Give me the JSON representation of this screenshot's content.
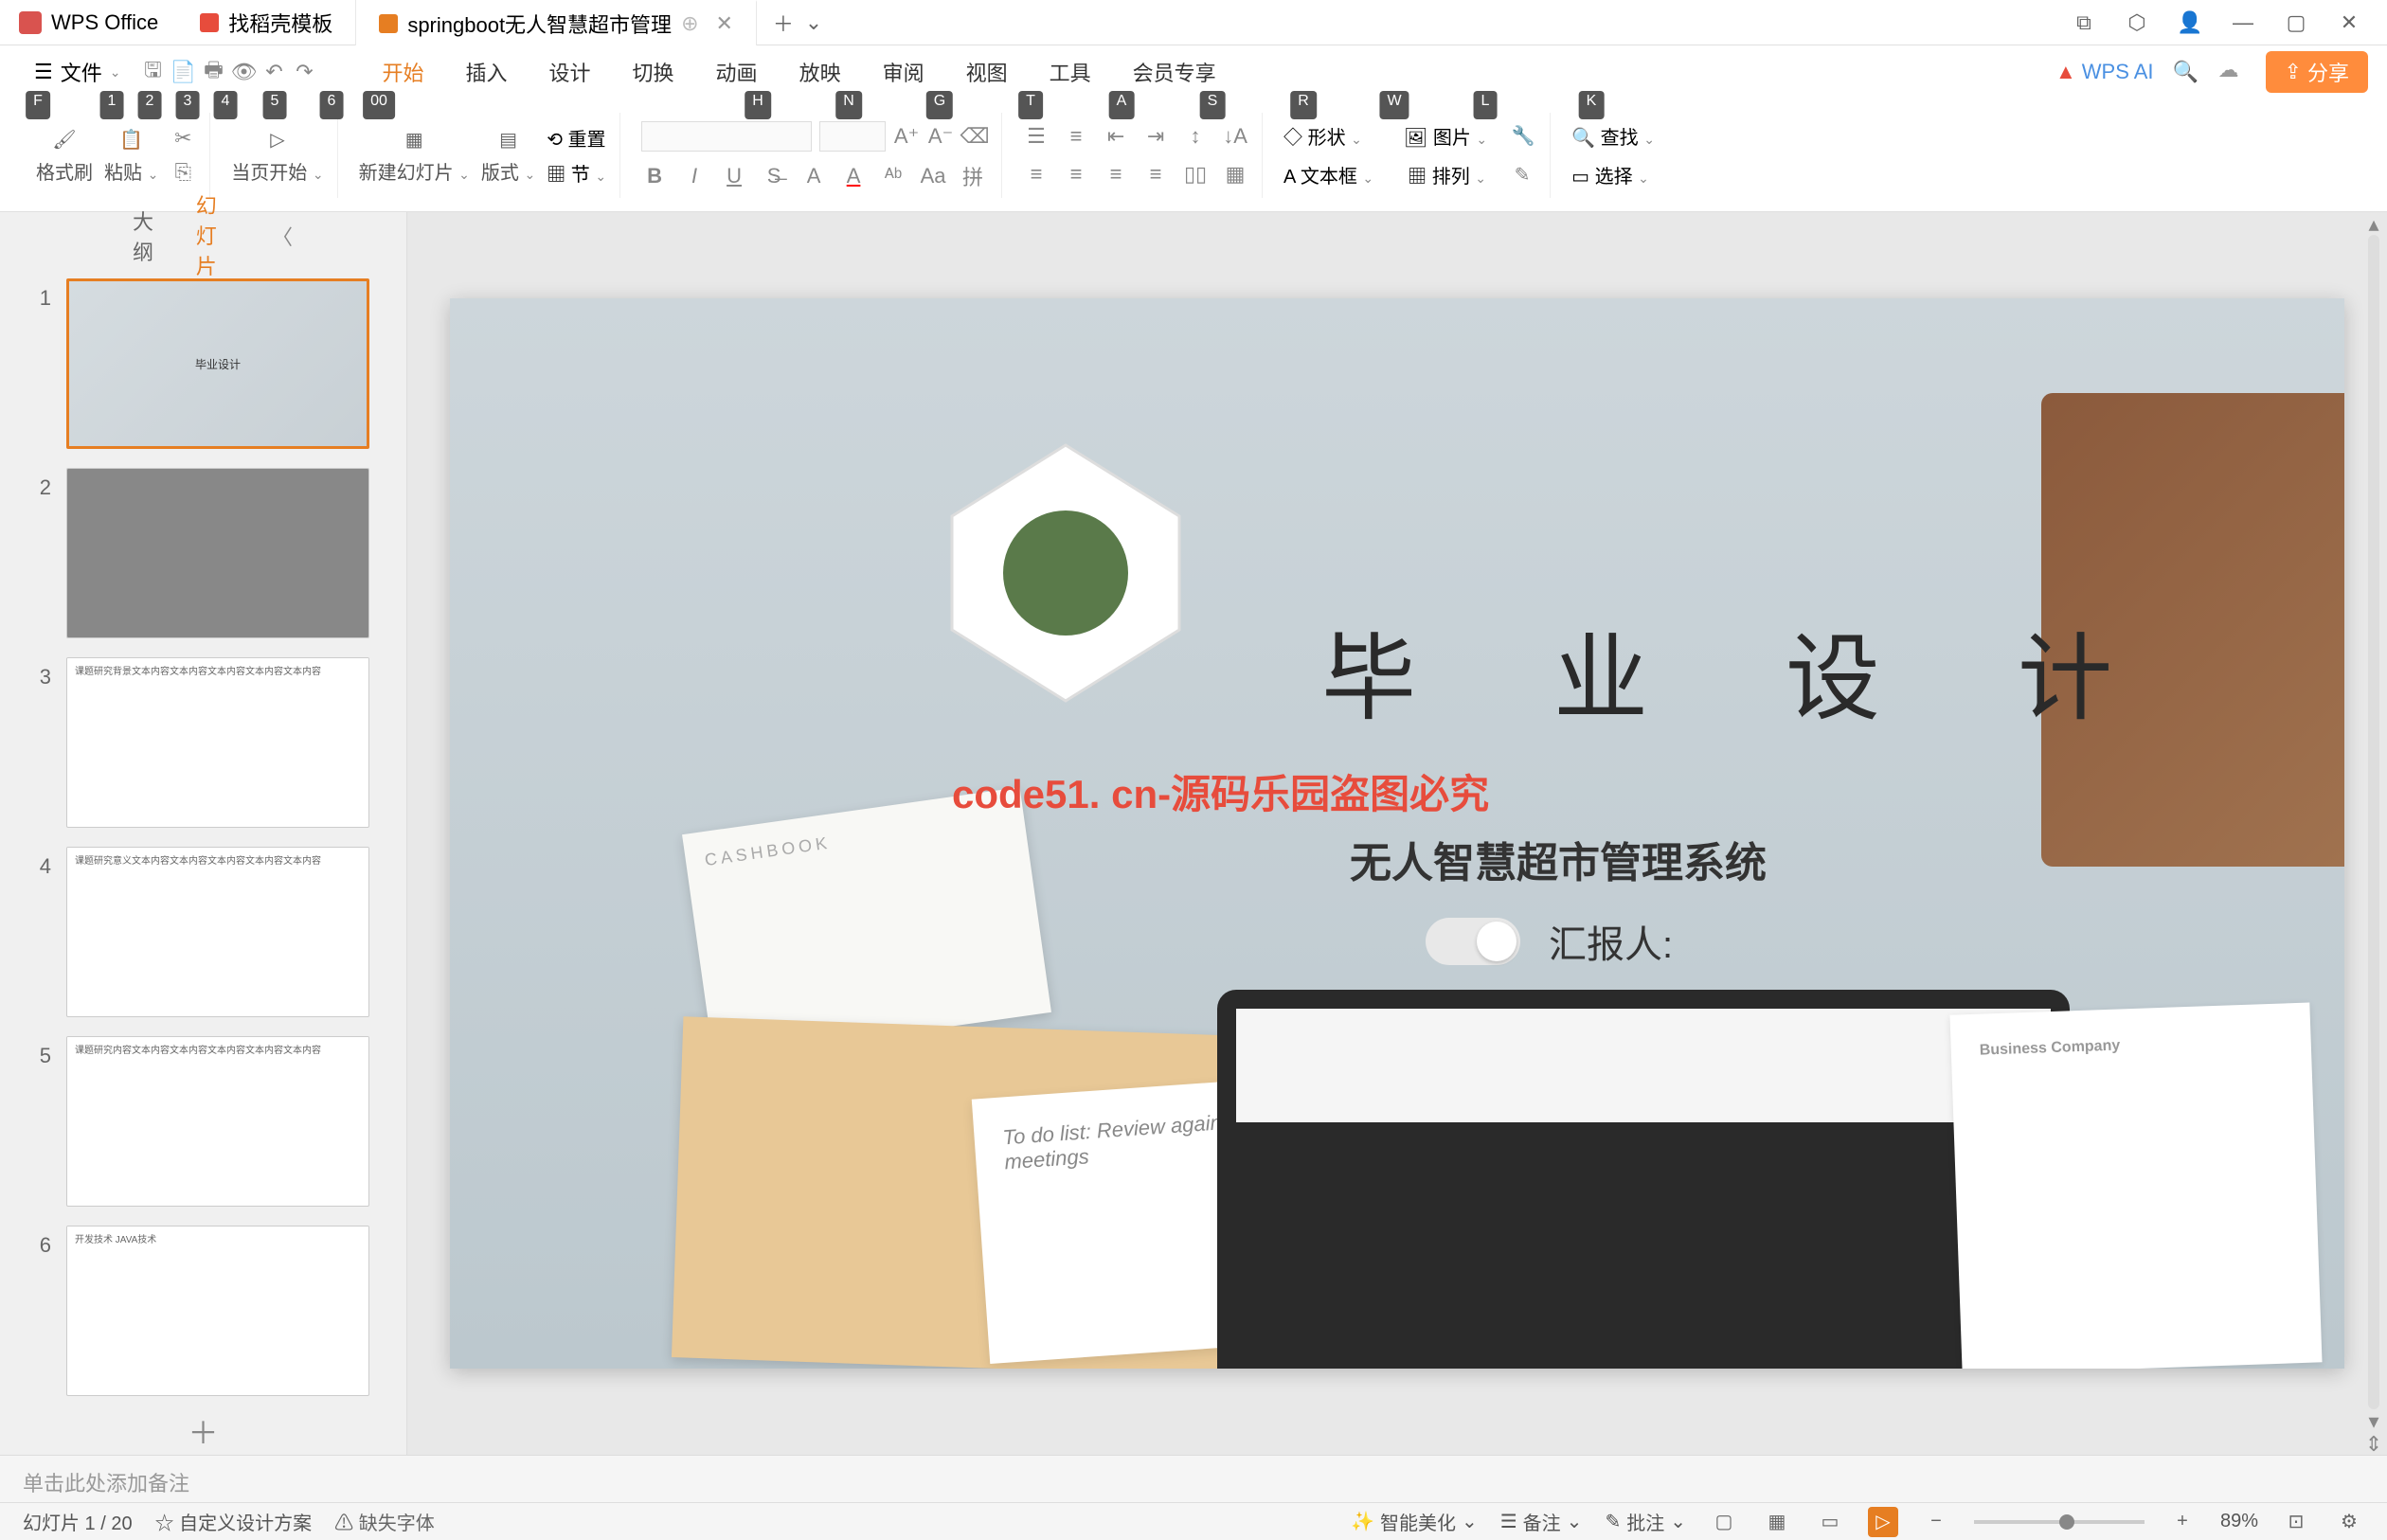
{
  "app": {
    "name": "WPS Office"
  },
  "tabs": [
    {
      "label": "找稻壳模板"
    },
    {
      "label": "springboot无人智慧超市管理",
      "active": true
    }
  ],
  "menu": {
    "file": "文件",
    "items": [
      {
        "label": "开始",
        "key": "H",
        "active": true
      },
      {
        "label": "插入",
        "key": "N"
      },
      {
        "label": "设计",
        "key": "G"
      },
      {
        "label": "切换",
        "key": "T"
      },
      {
        "label": "动画",
        "key": "A"
      },
      {
        "label": "放映",
        "key": "S"
      },
      {
        "label": "审阅",
        "key": "R"
      },
      {
        "label": "视图",
        "key": "W"
      },
      {
        "label": "工具",
        "key": "L"
      },
      {
        "label": "会员专享",
        "key": "K"
      }
    ],
    "wpsai": "WPS AI",
    "share": "分享",
    "file_key": "F",
    "quick_keys": [
      "1",
      "2",
      "3",
      "4",
      "5",
      "6",
      "00"
    ]
  },
  "toolbar": {
    "format_brush": "格式刷",
    "paste": "粘贴",
    "from_current": "当页开始",
    "new_slide": "新建幻灯片",
    "layout": "版式",
    "section": "节",
    "reset": "重置",
    "shape": "形状",
    "picture": "图片",
    "textbox": "文本框",
    "arrange": "排列",
    "find": "查找",
    "select": "选择"
  },
  "sidebar": {
    "tabs": {
      "outline": "大纲",
      "slides": "幻灯片"
    },
    "thumbs": [
      1,
      2,
      3,
      4,
      5,
      6
    ]
  },
  "slide": {
    "title": "毕 业 设 计",
    "watermark": "code51. cn-源码乐园盗图必究",
    "subtitle": "无人智慧超市管理系统",
    "reporter_label": "汇报人:",
    "cashbook": "CASHBOOK",
    "paper_header": "Business Company",
    "card_text": "To do list:\nReview again to...\nOnline meetings"
  },
  "notes": {
    "placeholder": "单击此处添加备注"
  },
  "status": {
    "slide_info": "幻灯片 1 / 20",
    "custom_scheme": "自定义设计方案",
    "missing_font": "缺失字体",
    "smart_beautify": "智能美化",
    "notes_btn": "备注",
    "review_btn": "批注",
    "zoom": "89%"
  },
  "watermark_text": "code51.cn"
}
